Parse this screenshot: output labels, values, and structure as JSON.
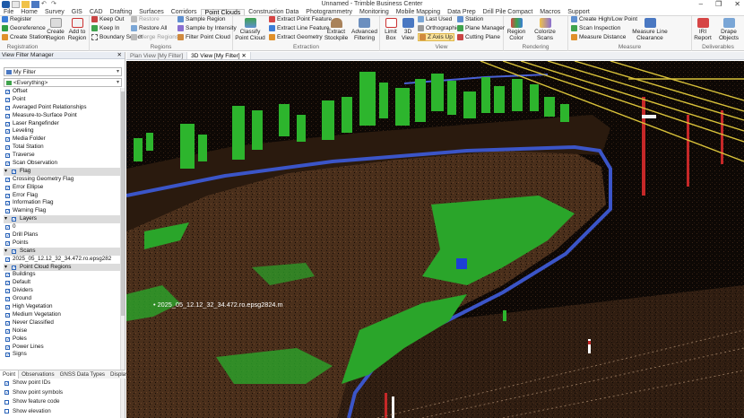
{
  "window": {
    "title": "Unnamed - Trimble Business Center",
    "controls": [
      "–",
      "❐",
      "✕"
    ]
  },
  "menu_tabs": [
    {
      "label": "File",
      "active": false
    },
    {
      "label": "Home",
      "active": false
    },
    {
      "label": "Survey",
      "active": false
    },
    {
      "label": "GIS",
      "active": false
    },
    {
      "label": "CAD",
      "active": false
    },
    {
      "label": "Drafting",
      "active": false
    },
    {
      "label": "Surfaces",
      "active": false
    },
    {
      "label": "Corridors",
      "active": false
    },
    {
      "label": "Point Clouds",
      "active": true
    },
    {
      "label": "Construction Data",
      "active": false
    },
    {
      "label": "Photogrammetry",
      "active": false
    },
    {
      "label": "Monitoring",
      "active": false
    },
    {
      "label": "Mobile Mapping",
      "active": false
    },
    {
      "label": "Data Prep",
      "active": false
    },
    {
      "label": "Drill Pile Compact",
      "active": false
    },
    {
      "label": "Macros",
      "active": false
    },
    {
      "label": "Support",
      "active": false
    }
  ],
  "ribbon": {
    "registration": {
      "group_label": "Registration",
      "items": [
        "Register",
        "Georeference",
        "Create Station"
      ],
      "create_region": "Create Region",
      "add_to_region": "Add to Region"
    },
    "regions": {
      "group_label": "Regions",
      "keep_out": "Keep Out",
      "keep_in": "Keep In",
      "boundary_select": "Boundary Select",
      "restore": "Restore",
      "restore_all": "Restore All",
      "merge_regions": "Merge Regions",
      "sample_region": "Sample Region",
      "sample_by_intensity": "Sample by Intensity",
      "filter_point_cloud": "Filter Point Cloud"
    },
    "extraction": {
      "group_label": "Extraction",
      "classify": "Classify Point Cloud",
      "extract_point_feature": "Extract Point Feature",
      "extract_line_feature": "Extract Line Feature",
      "extract_geometry": "Extract Geometry",
      "extract_stockpile": "Extract Stockpile",
      "advanced_filtering": "Advanced Filtering"
    },
    "view": {
      "group_label": "View",
      "limit_box": "Limit Box",
      "view_3d": "3D View",
      "last_used": "Last Used",
      "orthographic": "Orthographic",
      "z_axis_up": "Z Axis Up",
      "station": "Station",
      "plane_manager": "Plane Manager",
      "cutting_plane": "Cutting Plane"
    },
    "rendering": {
      "group_label": "Rendering",
      "region_color": "Region Color",
      "colorize_scans": "Colorize Scans"
    },
    "measure": {
      "group_label": "Measure",
      "create_high_low": "Create High/Low Point",
      "scan_inspection": "Scan Inspection",
      "measure_distance": "Measure Distance",
      "measure_line_clearance": "Measure Line Clearance"
    },
    "deliverables": {
      "group_label": "Deliverables",
      "iri_report": "IRI Report",
      "drape_objects": "Drape Objects"
    }
  },
  "left_panel": {
    "title": "View Filter Manager",
    "filter_combo": "My Filter",
    "scope_combo": "<Everything>",
    "tree": [
      {
        "label": "Offset",
        "checked": true,
        "header": false
      },
      {
        "label": "Point",
        "checked": true,
        "header": false
      },
      {
        "label": "Averaged Point Relationships",
        "checked": true,
        "header": false
      },
      {
        "label": "Measure-to-Surface Point",
        "checked": true,
        "header": false
      },
      {
        "label": "Laser Rangefinder",
        "checked": true,
        "header": false
      },
      {
        "label": "Leveling",
        "checked": true,
        "header": false
      },
      {
        "label": "Media Folder",
        "checked": true,
        "header": false
      },
      {
        "label": "Total Station",
        "checked": true,
        "header": false
      },
      {
        "label": "Traverse",
        "checked": true,
        "header": false
      },
      {
        "label": "Scan Observation",
        "checked": true,
        "header": false
      },
      {
        "label": "Flag",
        "checked": true,
        "header": true
      },
      {
        "label": "Crossing Geometry Flag",
        "checked": true,
        "header": false
      },
      {
        "label": "Error Ellipse",
        "checked": true,
        "header": false
      },
      {
        "label": "Error Flag",
        "checked": true,
        "header": false
      },
      {
        "label": "Information Flag",
        "checked": true,
        "header": false
      },
      {
        "label": "Warning Flag",
        "checked": true,
        "header": false
      },
      {
        "label": "Layers",
        "checked": true,
        "header": true
      },
      {
        "label": "0",
        "checked": true,
        "header": false
      },
      {
        "label": "Drill Plans",
        "checked": true,
        "header": false
      },
      {
        "label": "Points",
        "checked": true,
        "header": false
      },
      {
        "label": "Scans",
        "checked": true,
        "header": true
      },
      {
        "label": "2025_05_12.12_32_34.472.ro.epsg282",
        "checked": true,
        "header": false
      },
      {
        "label": "Point Cloud Regions",
        "checked": true,
        "header": true
      },
      {
        "label": "Buildings",
        "checked": true,
        "header": false
      },
      {
        "label": "Default",
        "checked": true,
        "header": false
      },
      {
        "label": "Dividers",
        "checked": true,
        "header": false
      },
      {
        "label": "Ground",
        "checked": true,
        "header": false
      },
      {
        "label": "High Vegetation",
        "checked": true,
        "header": false
      },
      {
        "label": "Medium Vegetation",
        "checked": true,
        "header": false
      },
      {
        "label": "Never Classified",
        "checked": true,
        "header": false
      },
      {
        "label": "Noise",
        "checked": true,
        "header": false
      },
      {
        "label": "Poles",
        "checked": true,
        "header": false
      },
      {
        "label": "Power Lines",
        "checked": true,
        "header": false
      },
      {
        "label": "Signs",
        "checked": true,
        "header": false
      }
    ],
    "bottom_tabs": [
      "Point",
      "Observations",
      "GNSS Data Types",
      "Display"
    ],
    "options": [
      {
        "label": "Show point IDs",
        "checked": true
      },
      {
        "label": "Show point symbols",
        "checked": true
      },
      {
        "label": "Show feature code",
        "checked": false
      },
      {
        "label": "Show elevation",
        "checked": false
      }
    ]
  },
  "view_tabs": [
    {
      "label": "Plan View [My Filter]",
      "active": false
    },
    {
      "label": "3D View [My Filter]",
      "active": true
    }
  ],
  "viewport": {
    "point_label": "2025_05_12.12_32_34.472.ro.epsg2824.m"
  },
  "colors": {
    "ground": "#5a3a22",
    "vegetation": "#2db52d",
    "divider": "#3b55c8",
    "power_lines": "#d9c23a",
    "poles": "#c62828",
    "accent": "#2a63b8"
  }
}
